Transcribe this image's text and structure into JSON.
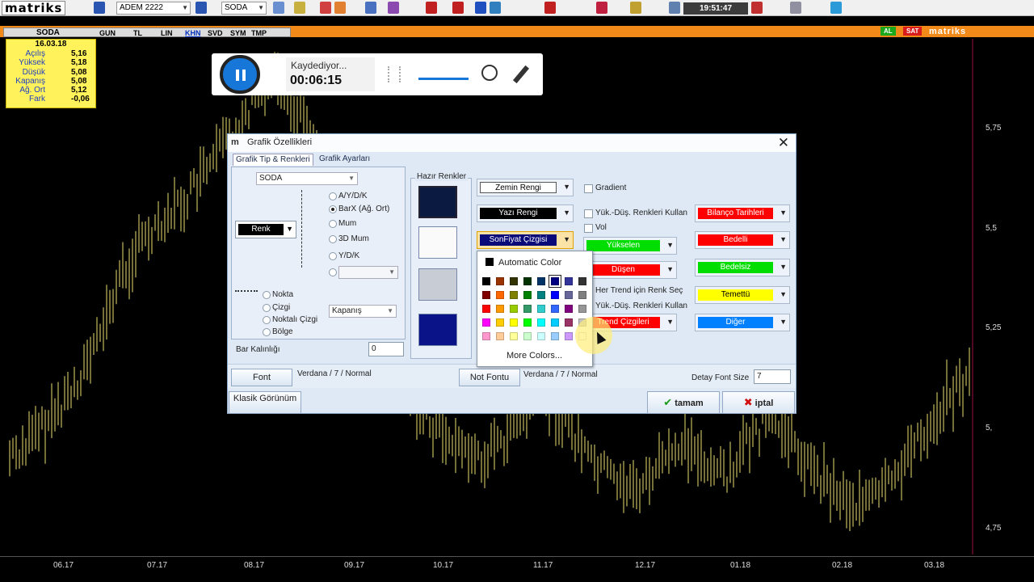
{
  "toolbar": {
    "brand": "matriks",
    "user": "ADEM 2222",
    "symbol": "SODA",
    "clock": "19:51:47"
  },
  "tabbar": {
    "symbol": "SODA",
    "buttons": [
      "GUN",
      "TL",
      "LIN",
      "KHN",
      "SVD",
      "SYM",
      "TMP"
    ],
    "active": "KHN",
    "al": "AL",
    "sat": "SAT",
    "brand": "matriks"
  },
  "info": {
    "date": "16.03.18",
    "rows": [
      {
        "label": "Açılış",
        "value": "5,16"
      },
      {
        "label": "Yüksek",
        "value": "5,18"
      },
      {
        "label": "Düşük",
        "value": "5,08"
      },
      {
        "label": "Kapanış",
        "value": "5,08"
      },
      {
        "label": "Ağ. Ort",
        "value": "5,12"
      },
      {
        "label": "Fark",
        "value": "-0,06"
      }
    ]
  },
  "recorder": {
    "status": "Kaydediyor...",
    "time": "00:06:15"
  },
  "axis": {
    "y": [
      "5,75",
      "5,5",
      "5,25",
      "5,",
      "4,75"
    ],
    "x": [
      "06.17",
      "07.17",
      "08.17",
      "09.17",
      "10.17",
      "11.17",
      "12.17",
      "01.18",
      "02.18",
      "03.18"
    ]
  },
  "dialog": {
    "title": "Grafik Özellikleri",
    "tabs": [
      "Grafik Tip & Renkleri",
      "Grafik Ayarları"
    ],
    "symbol": "SODA",
    "renk": "Renk",
    "chart_types": [
      "A/Y/D/K",
      "BarX  (Ağ. Ort)",
      "Mum",
      "3D Mum",
      "Y/D/K"
    ],
    "line_types": [
      "Nokta",
      "Çizgi",
      "Noktalı Çizgi",
      "Bölge"
    ],
    "line_source": "Kapanış",
    "bar_width_label": "Bar Kalınlığı",
    "bar_width_value": "0",
    "presets_label": "Hazır Renkler",
    "color_buttons": {
      "zemin": "Zemin Rengi",
      "yazi": "Yazı Rengi",
      "sonfiyat": "SonFiyat Çizgisi",
      "yukselen": "Yükselen",
      "dusen": "Düşen",
      "trend": "Trend Çizgileri"
    },
    "checks": {
      "gradient": "Gradient",
      "yukdus": "Yük.-Düş. Renkleri Kullan",
      "vol": "Vol",
      "her_trend": "Her Trend için Renk Seç",
      "yukdus2": "Yük.-Düş. Renkleri Kullan"
    },
    "right_buttons": [
      "Bilanço Tarihleri",
      "Bedelli",
      "Bedelsiz",
      "Temettü",
      "Diğer"
    ],
    "font_btn": "Font",
    "font_desc": "Verdana / 7 / Normal",
    "note_font_btn": "Not Fontu",
    "note_font_desc": "Verdana / 7 / Normal",
    "detail_font_label": "Detay Font Size",
    "detail_font_value": "7",
    "classic_btn": "Klasik Görünüm",
    "ok_btn": "tamam",
    "cancel_btn": "iptal"
  },
  "picker": {
    "automatic": "Automatic Color",
    "more": "More Colors...",
    "rows": [
      [
        "#000000",
        "#993300",
        "#333300",
        "#003300",
        "#003366",
        "#000080",
        "#333399",
        "#333333"
      ],
      [
        "#800000",
        "#ff6600",
        "#808000",
        "#008000",
        "#008080",
        "#0000ff",
        "#666699",
        "#808080"
      ],
      [
        "#ff0000",
        "#ff9900",
        "#99cc00",
        "#339966",
        "#33cccc",
        "#3366ff",
        "#800080",
        "#969696"
      ],
      [
        "#ff00ff",
        "#ffcc00",
        "#ffff00",
        "#00ff00",
        "#00ffff",
        "#00ccff",
        "#993366",
        "#c0c0c0"
      ],
      [
        "#ff99cc",
        "#ffcc99",
        "#ffff99",
        "#ccffcc",
        "#ccffff",
        "#99ccff",
        "#cc99ff",
        "#ffffff"
      ]
    ]
  },
  "colors": {
    "rise": "#00dd00",
    "fall": "#ff0000",
    "trend": "#ff0000",
    "chart_bars": "#e8e070"
  }
}
